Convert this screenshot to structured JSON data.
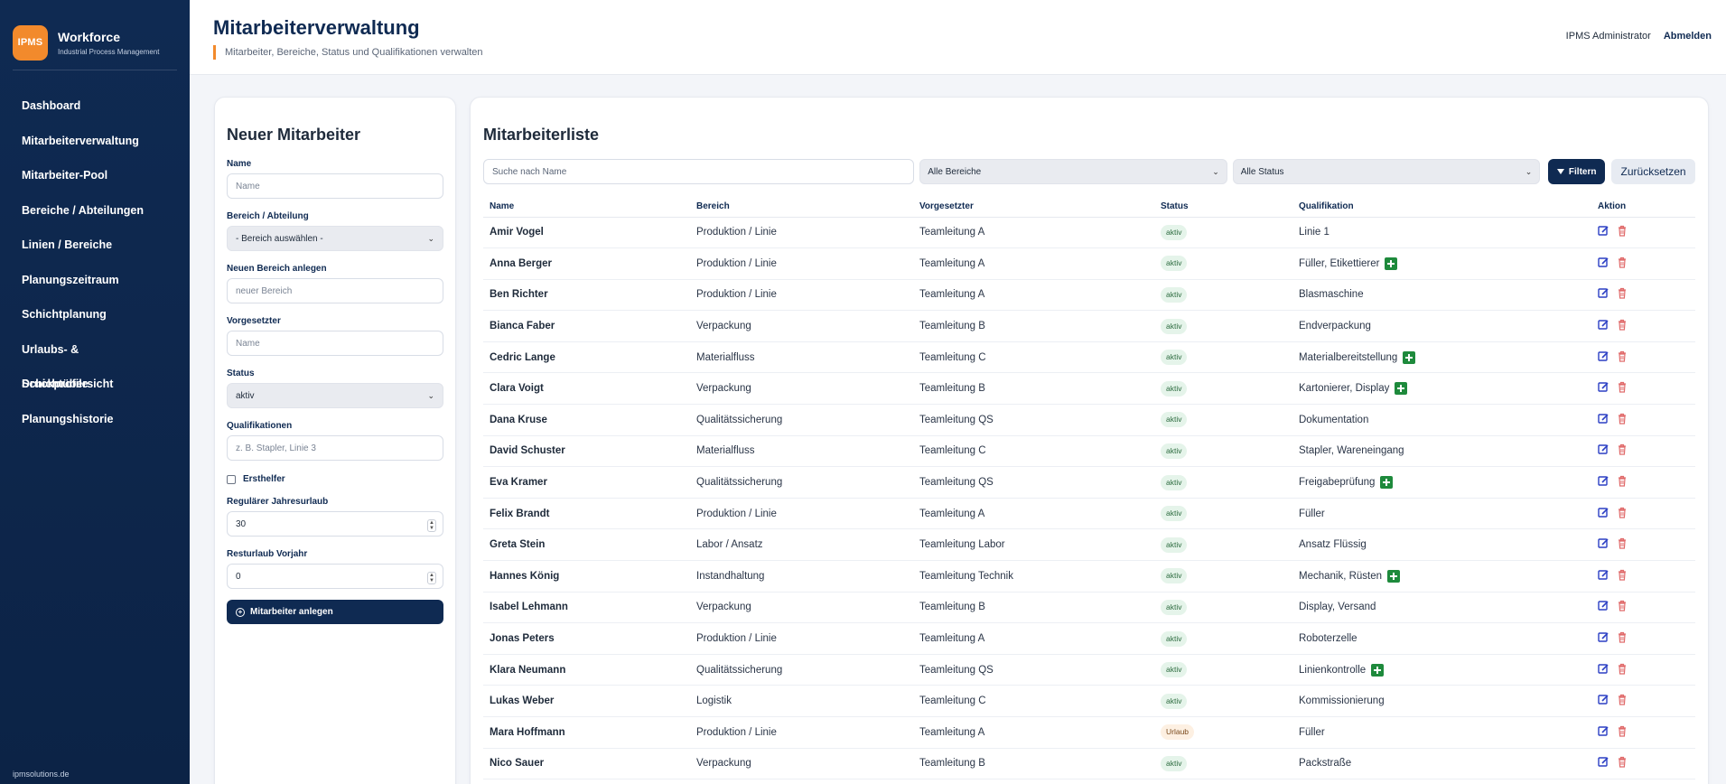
{
  "brand": {
    "logo": "IPMS",
    "title": "Workforce",
    "subtitle": "Industrial Process Management"
  },
  "nav": [
    "Dashboard",
    "Mitarbeiterverwaltung",
    "Mitarbeiter-Pool",
    "Bereiche / Abteilungen",
    "Linien / Bereiche",
    "Planungszeitraum",
    "Schichtplanung",
    "Urlaubs- & Schichtübersicht",
    "Druckprofile",
    "Planungshistorie"
  ],
  "footer": "ipmsolutions.de",
  "header": {
    "title": "Mitarbeiterverwaltung",
    "subtitle": "Mitarbeiter, Bereiche, Status und Qualifikationen verwalten",
    "user": "IPMS Administrator",
    "logout": "Abmelden"
  },
  "form": {
    "title": "Neuer Mitarbeiter",
    "name_label": "Name",
    "name_placeholder": "Name",
    "bereich_label": "Bereich / Abteilung",
    "bereich_value": "- Bereich auswählen -",
    "new_bereich_label": "Neuen Bereich anlegen",
    "new_bereich_placeholder": "neuer Bereich",
    "vorgesetzter_label": "Vorgesetzter",
    "vorgesetzter_placeholder": "Name",
    "status_label": "Status",
    "status_value": "aktiv",
    "qual_label": "Qualifikationen",
    "qual_placeholder": "z. B. Stapler, Linie 3",
    "ersthelfer_label": "Ersthelfer",
    "urlaub_label": "Regulärer Jahresurlaub",
    "urlaub_value": "30",
    "rest_label": "Resturlaub Vorjahr",
    "rest_value": "0",
    "submit": "Mitarbeiter anlegen"
  },
  "list": {
    "title": "Mitarbeiterliste",
    "search_placeholder": "Suche nach Name",
    "bereich_filter": "Alle Bereiche",
    "status_filter": "Alle Status",
    "filter_btn": "Filtern",
    "reset_btn": "Zurücksetzen",
    "columns": [
      "Name",
      "Bereich",
      "Vorgesetzter",
      "Status",
      "Qualifikation",
      "Aktion"
    ],
    "rows": [
      {
        "name": "Amir Vogel",
        "bereich": "Produktion / Linie",
        "vorgesetzter": "Teamleitung A",
        "status": "aktiv",
        "qual": "Linie 1",
        "ersthelfer": false
      },
      {
        "name": "Anna Berger",
        "bereich": "Produktion / Linie",
        "vorgesetzter": "Teamleitung A",
        "status": "aktiv",
        "qual": "Füller, Etikettierer",
        "ersthelfer": true
      },
      {
        "name": "Ben Richter",
        "bereich": "Produktion / Linie",
        "vorgesetzter": "Teamleitung A",
        "status": "aktiv",
        "qual": "Blasmaschine",
        "ersthelfer": false
      },
      {
        "name": "Bianca Faber",
        "bereich": "Verpackung",
        "vorgesetzter": "Teamleitung B",
        "status": "aktiv",
        "qual": "Endverpackung",
        "ersthelfer": false
      },
      {
        "name": "Cedric Lange",
        "bereich": "Materialfluss",
        "vorgesetzter": "Teamleitung C",
        "status": "aktiv",
        "qual": "Materialbereitstellung",
        "ersthelfer": true
      },
      {
        "name": "Clara Voigt",
        "bereich": "Verpackung",
        "vorgesetzter": "Teamleitung B",
        "status": "aktiv",
        "qual": "Kartonierer, Display",
        "ersthelfer": true
      },
      {
        "name": "Dana Kruse",
        "bereich": "Qualitätssicherung",
        "vorgesetzter": "Teamleitung QS",
        "status": "aktiv",
        "qual": "Dokumentation",
        "ersthelfer": false
      },
      {
        "name": "David Schuster",
        "bereich": "Materialfluss",
        "vorgesetzter": "Teamleitung C",
        "status": "aktiv",
        "qual": "Stapler, Wareneingang",
        "ersthelfer": false
      },
      {
        "name": "Eva Kramer",
        "bereich": "Qualitätssicherung",
        "vorgesetzter": "Teamleitung QS",
        "status": "aktiv",
        "qual": "Freigabeprüfung",
        "ersthelfer": true
      },
      {
        "name": "Felix Brandt",
        "bereich": "Produktion / Linie",
        "vorgesetzter": "Teamleitung A",
        "status": "aktiv",
        "qual": "Füller",
        "ersthelfer": false
      },
      {
        "name": "Greta Stein",
        "bereich": "Labor / Ansatz",
        "vorgesetzter": "Teamleitung Labor",
        "status": "aktiv",
        "qual": "Ansatz Flüssig",
        "ersthelfer": false
      },
      {
        "name": "Hannes König",
        "bereich": "Instandhaltung",
        "vorgesetzter": "Teamleitung Technik",
        "status": "aktiv",
        "qual": "Mechanik, Rüsten",
        "ersthelfer": true
      },
      {
        "name": "Isabel Lehmann",
        "bereich": "Verpackung",
        "vorgesetzter": "Teamleitung B",
        "status": "aktiv",
        "qual": "Display, Versand",
        "ersthelfer": false
      },
      {
        "name": "Jonas Peters",
        "bereich": "Produktion / Linie",
        "vorgesetzter": "Teamleitung A",
        "status": "aktiv",
        "qual": "Roboterzelle",
        "ersthelfer": false
      },
      {
        "name": "Klara Neumann",
        "bereich": "Qualitätssicherung",
        "vorgesetzter": "Teamleitung QS",
        "status": "aktiv",
        "qual": "Linienkontrolle",
        "ersthelfer": true
      },
      {
        "name": "Lukas Weber",
        "bereich": "Logistik",
        "vorgesetzter": "Teamleitung C",
        "status": "aktiv",
        "qual": "Kommissionierung",
        "ersthelfer": false
      },
      {
        "name": "Mara Hoffmann",
        "bereich": "Produktion / Linie",
        "vorgesetzter": "Teamleitung A",
        "status": "Urlaub",
        "qual": "Füller",
        "ersthelfer": false
      },
      {
        "name": "Nico Sauer",
        "bereich": "Verpackung",
        "vorgesetzter": "Teamleitung B",
        "status": "aktiv",
        "qual": "Packstraße",
        "ersthelfer": false
      }
    ]
  },
  "colors": {
    "navy": "#0f2a52",
    "accent": "#f28a2c",
    "first_aid": "#1e8a3c",
    "edit": "#2b3fc4",
    "delete": "#e06a6a"
  },
  "icons": {
    "edit": "edit-icon",
    "delete": "trash-icon",
    "first_aid": "first-aid-icon",
    "filter": "funnel-icon",
    "add": "plus-circle-icon"
  }
}
